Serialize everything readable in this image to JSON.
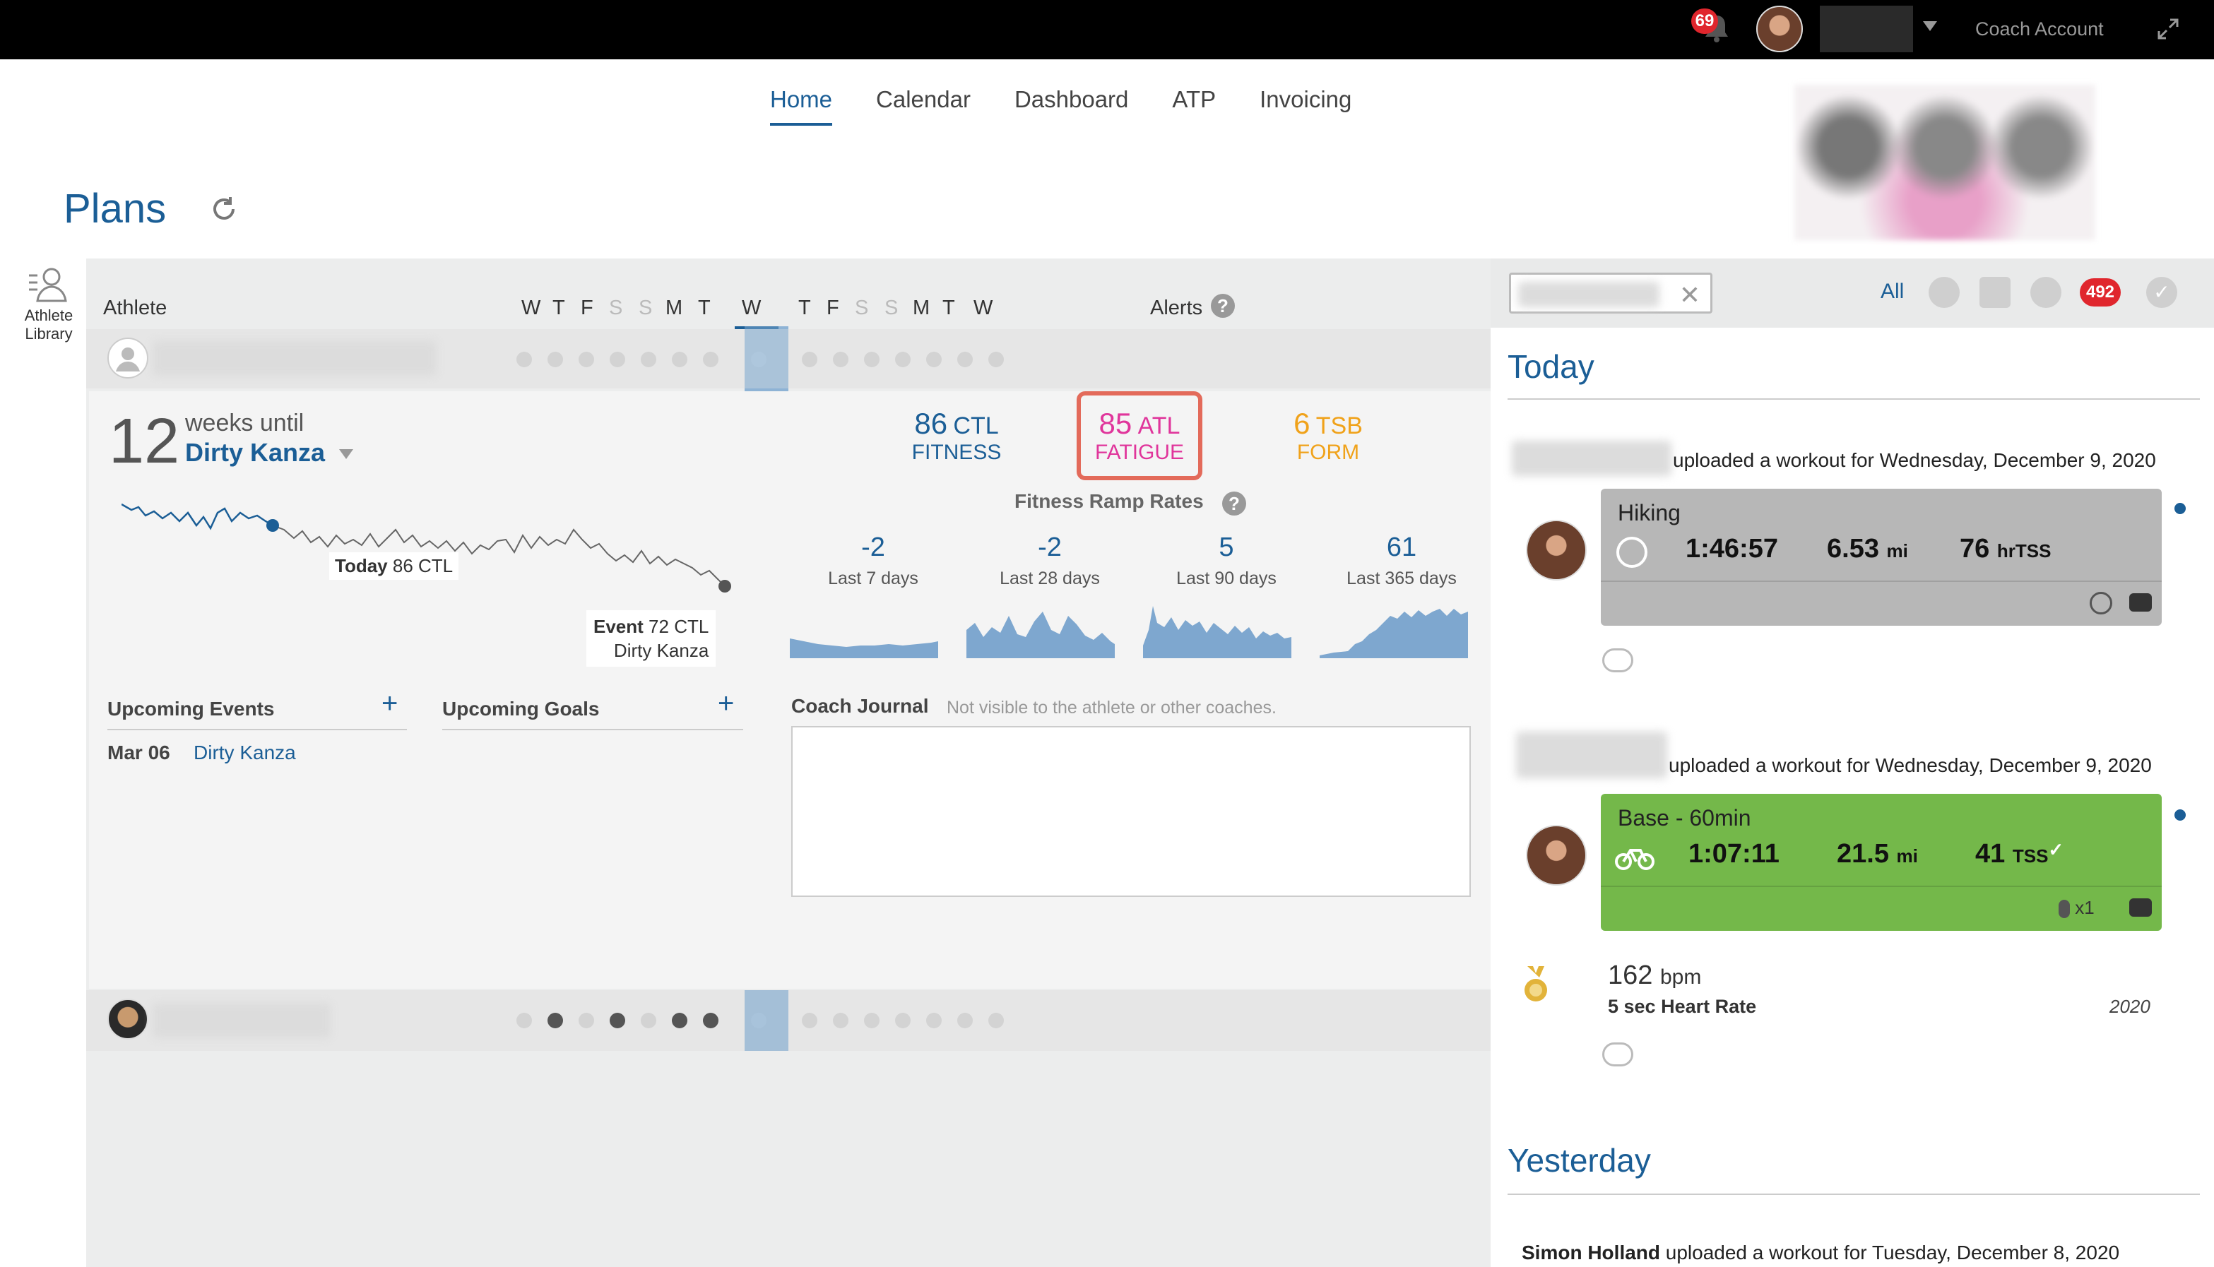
{
  "topbar": {
    "notifications_count": "69",
    "account_label": "Coach Account"
  },
  "nav": {
    "items": [
      "Home",
      "Calendar",
      "Dashboard",
      "ATP",
      "Invoicing"
    ],
    "active": "Home"
  },
  "page": {
    "title": "Plans"
  },
  "sidebar": {
    "library_label_1": "Athlete",
    "library_label_2": "Library"
  },
  "grid": {
    "athlete_col": "Athlete",
    "days": [
      "W",
      "T",
      "F",
      "S",
      "S",
      "M",
      "T",
      "W",
      "T",
      "F",
      "S",
      "S",
      "M",
      "T",
      "W"
    ],
    "alerts_col": "Alerts"
  },
  "athlete": {
    "weeks_number": "12",
    "weeks_until_label": "weeks until",
    "event_name": "Dirty Kanza",
    "chart_today_label": "Today",
    "chart_today_value": "86 CTL",
    "chart_event_label": "Event",
    "chart_event_value": "72 CTL",
    "chart_event_name": "Dirty Kanza",
    "ctl_value": "86",
    "ctl_unit": "CTL",
    "ctl_label": "FITNESS",
    "atl_value": "85",
    "atl_unit": "ATL",
    "atl_label": "FATIGUE",
    "tsb_value": "6",
    "tsb_unit": "TSB",
    "tsb_label": "FORM",
    "ramp_title": "Fitness Ramp Rates",
    "ramp_rates": [
      {
        "value": "-2",
        "label": "Last 7 days"
      },
      {
        "value": "-2",
        "label": "Last 28 days"
      },
      {
        "value": "5",
        "label": "Last 90 days"
      },
      {
        "value": "61",
        "label": "Last 365 days"
      }
    ],
    "upcoming_events_title": "Upcoming Events",
    "upcoming_goals_title": "Upcoming Goals",
    "event_date": "Mar 06",
    "event_link": "Dirty Kanza",
    "coach_journal_title": "Coach Journal",
    "coach_journal_note": "Not visible to the athlete or other coaches."
  },
  "feed": {
    "filter_all": "All",
    "count_badge": "492",
    "today_heading": "Today",
    "item1_text": "uploaded a workout for Wednesday, December 9, 2020",
    "card1": {
      "title": "Hiking",
      "duration": "1:46:57",
      "distance": "6.53",
      "distance_unit": "mi",
      "tss": "76",
      "tss_unit": "hrTSS"
    },
    "item2_text": "uploaded a workout for Wednesday, December 9, 2020",
    "card2": {
      "title": "Base - 60min",
      "duration": "1:07:11",
      "distance": "21.5",
      "distance_unit": "mi",
      "tss": "41",
      "tss_unit": "TSS",
      "medal_count": "x1"
    },
    "pb_value": "162",
    "pb_unit": "bpm",
    "pb_label": "5 sec Heart Rate",
    "pb_year": "2020",
    "yesterday_heading": "Yesterday",
    "item3_name": "Simon Holland",
    "item3_text": "uploaded a workout for Tuesday, December 8, 2020"
  },
  "colors": {
    "brand_blue": "#1b5e96",
    "fatigue_pink": "#e0359b",
    "form_orange": "#f0a21a",
    "workout_green": "#74b84a",
    "alert_red": "#e0262d"
  }
}
